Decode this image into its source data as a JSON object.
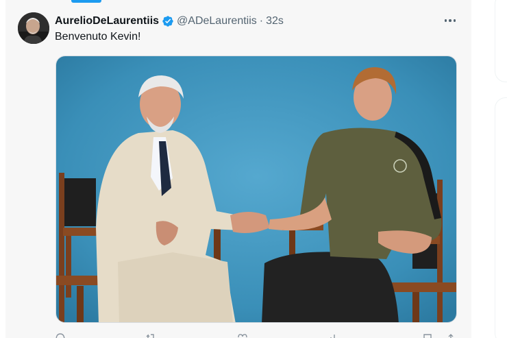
{
  "post": {
    "display_name": "AurelioDeLaurentiis",
    "handle": "@ADeLaurentiis",
    "separator": "·",
    "time": "32s",
    "text": "Benvenuto Kevin!"
  },
  "icons": {
    "verified": "verified-badge-icon",
    "more": "more-horizontal-icon",
    "reply": "reply-icon",
    "repost": "repost-icon",
    "like": "like-icon",
    "views": "views-icon",
    "bookmark": "bookmark-icon",
    "share": "share-icon"
  },
  "colors": {
    "accent": "#1d9bf0",
    "verified": "#1d9bf0",
    "photo_background": "#3f96bd",
    "text_primary": "#0f1419",
    "text_secondary": "#536471"
  }
}
